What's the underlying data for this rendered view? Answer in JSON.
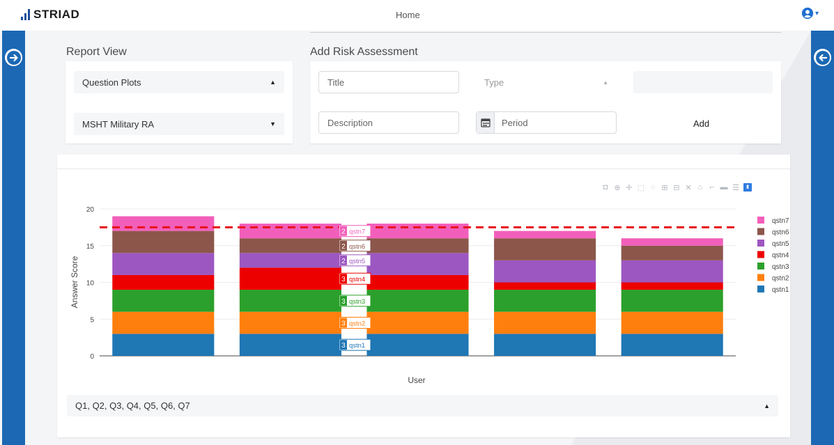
{
  "app": {
    "brand": "STRIAD",
    "nav_home": "Home"
  },
  "colors": {
    "rail": "#1c68b4",
    "accent": "#1f6fd1",
    "threshold": "#e8141b"
  },
  "report_view": {
    "title": "Report View",
    "select_1": "Question Plots",
    "select_2": "MSHT Military RA"
  },
  "add_risk": {
    "title": "Add Risk Assessment",
    "title_placeholder": "Title",
    "type_placeholder": "Type",
    "description_placeholder": "Description",
    "period_placeholder": "Period",
    "add_label": "Add"
  },
  "question_filter": {
    "value": "Q1, Q2, Q3, Q4, Q5, Q6, Q7"
  },
  "chart_data": {
    "type": "bar",
    "stacked": true,
    "categories": [
      "",
      "",
      "",
      "",
      ""
    ],
    "xlabel": "User",
    "ylabel": "Answer Score",
    "ylim": [
      0,
      20
    ],
    "yticks": [
      0,
      5,
      10,
      15,
      20
    ],
    "threshold": 17.5,
    "legend_position": "right",
    "series": [
      {
        "name": "qstn1",
        "color": "#1f77b4",
        "values": [
          3,
          3,
          3,
          3,
          3
        ]
      },
      {
        "name": "qstn2",
        "color": "#ff7f0e",
        "values": [
          3,
          3,
          3,
          3,
          3
        ]
      },
      {
        "name": "qstn3",
        "color": "#2ca02c",
        "values": [
          3,
          3,
          3,
          3,
          3
        ]
      },
      {
        "name": "qstn4",
        "color": "#ed0000",
        "values": [
          2,
          3,
          2,
          1,
          1
        ]
      },
      {
        "name": "qstn5",
        "color": "#9d57c1",
        "values": [
          3,
          2,
          3,
          3,
          3
        ]
      },
      {
        "name": "qstn6",
        "color": "#8c564b",
        "values": [
          3,
          2,
          2,
          3,
          2
        ]
      },
      {
        "name": "qstn7",
        "color": "#f25fbb",
        "values": [
          2,
          2,
          2,
          1,
          1
        ]
      }
    ],
    "hover": {
      "category_index": 1,
      "labels": [
        "3",
        "3",
        "3",
        "3",
        "2",
        "2",
        "2"
      ]
    }
  }
}
